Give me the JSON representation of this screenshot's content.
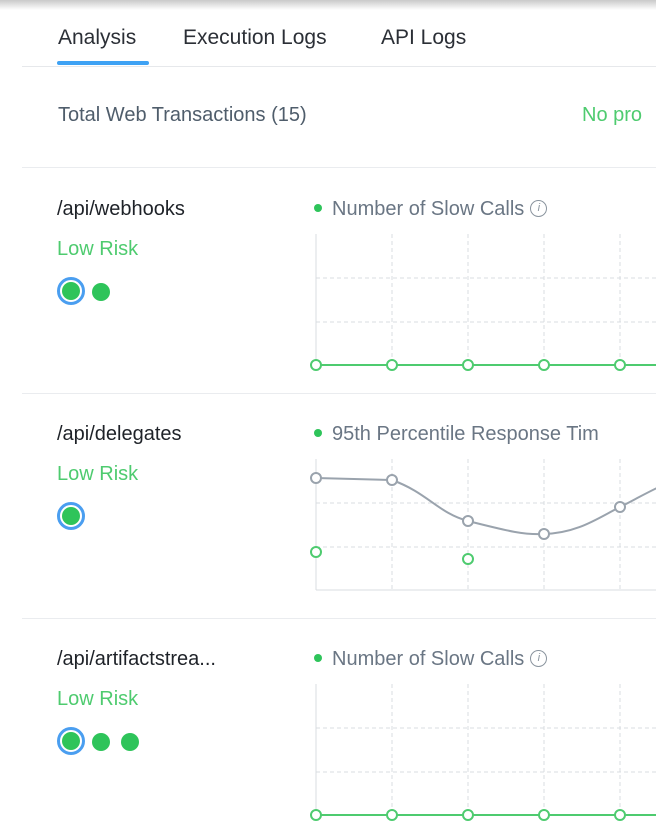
{
  "tabs": [
    {
      "label": "Analysis",
      "active": true
    },
    {
      "label": "Execution Logs",
      "active": false
    },
    {
      "label": "API Logs",
      "active": false
    }
  ],
  "summary": {
    "label": "Total Web Transactions (15)",
    "status": "No pro"
  },
  "colors": {
    "risk_green": "#4ecb6f",
    "dot_green": "#2ec45a",
    "selected_ring": "#4a9ef0",
    "tab_underline": "#3ea2f4",
    "grid": "#d8dce1"
  },
  "transactions": [
    {
      "name": "/api/webhooks",
      "risk": "Low Risk",
      "dots": 2,
      "metric": "Number of Slow Calls",
      "info_icon": "info-icon"
    },
    {
      "name": "/api/delegates",
      "risk": "Low Risk",
      "dots": 1,
      "metric": "95th Percentile Response Tim",
      "info_icon": ""
    },
    {
      "name": "/api/artifactstrea...",
      "risk": "Low Risk",
      "dots": 3,
      "metric": "Number of Slow Calls",
      "info_icon": "info-icon"
    }
  ]
}
